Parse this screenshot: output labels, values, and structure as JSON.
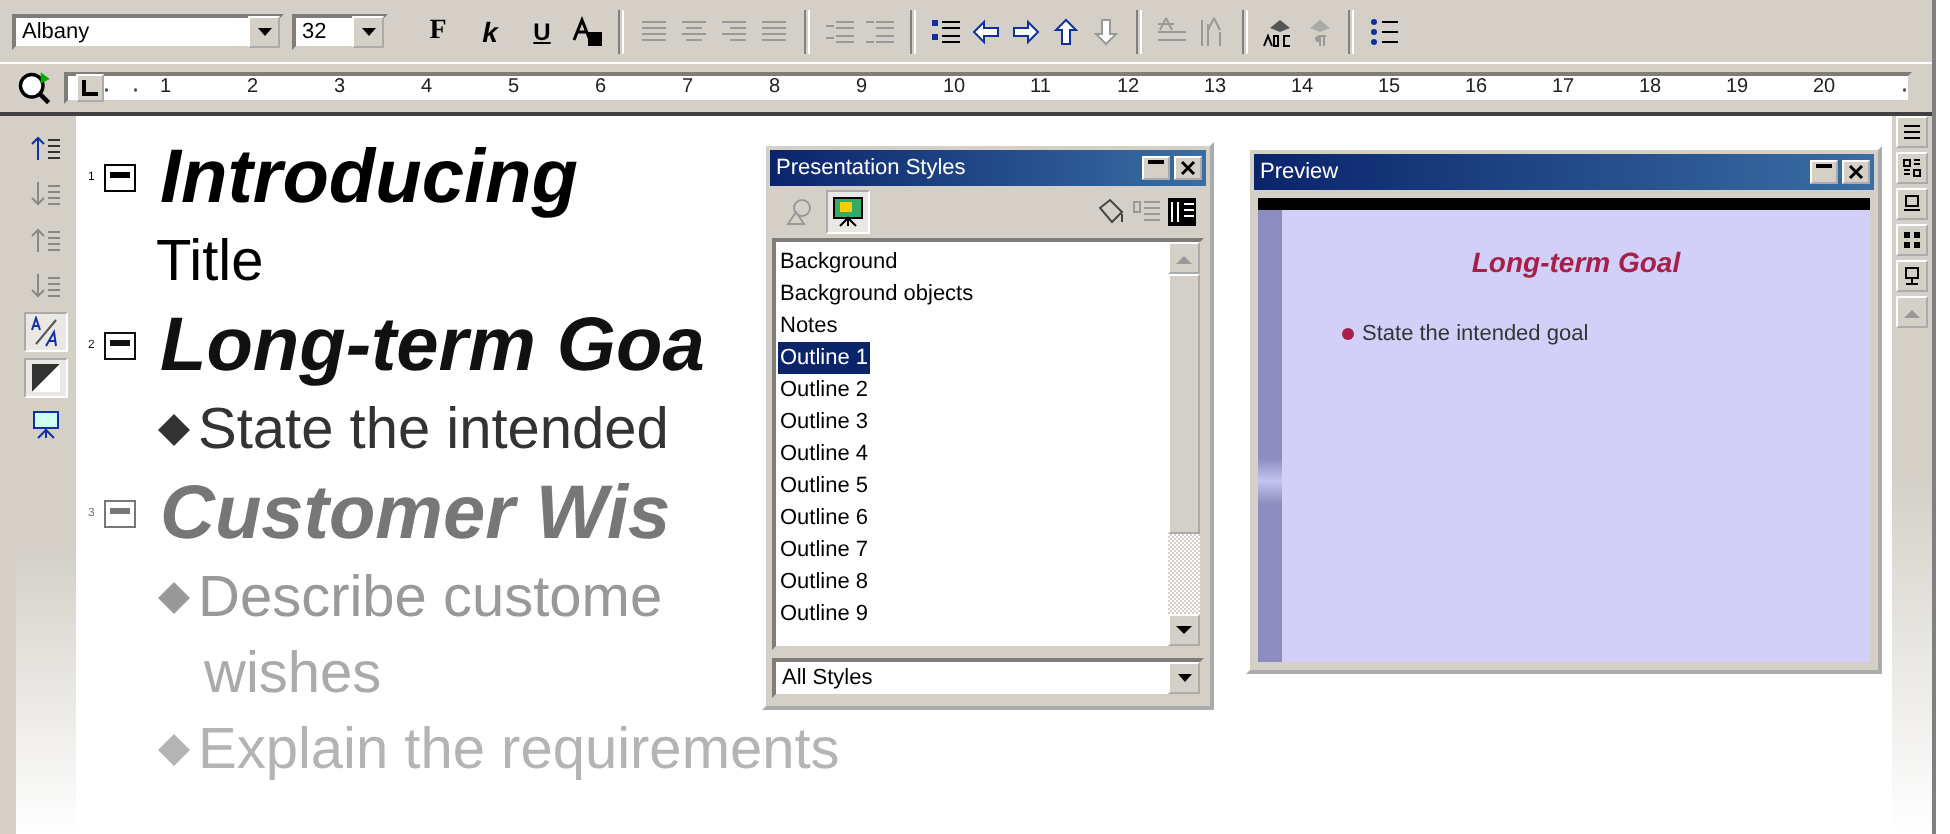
{
  "toolbar": {
    "font": "Albany",
    "size": "32",
    "format_buttons": [
      {
        "kind": "bold",
        "label": "F"
      },
      {
        "kind": "italic",
        "label": "k"
      },
      {
        "kind": "underline",
        "label": "U"
      }
    ]
  },
  "ruler": {
    "marks": [
      "1",
      "2",
      "3",
      "4",
      "5",
      "6",
      "7",
      "8",
      "9",
      "10",
      "11",
      "12",
      "13",
      "14",
      "15",
      "16",
      "17",
      "18",
      "19",
      "20"
    ]
  },
  "left_tools": [
    {
      "kind": "promote",
      "pressed": false
    },
    {
      "kind": "demote",
      "pressed": false
    },
    {
      "kind": "move-up",
      "pressed": false
    },
    {
      "kind": "move-down",
      "pressed": false
    },
    {
      "kind": "format",
      "pressed": true
    },
    {
      "kind": "black-white",
      "pressed": true
    },
    {
      "kind": "slide-show",
      "pressed": false
    }
  ],
  "outline": [
    {
      "kind": "title",
      "number": "1",
      "text": "Introducing"
    },
    {
      "kind": "subtitle",
      "text": "Title"
    },
    {
      "kind": "title",
      "number": "2",
      "text": "Long-term Goa"
    },
    {
      "kind": "bullet",
      "text": "State the intended"
    },
    {
      "kind": "title",
      "number": "3",
      "text": "Customer Wis"
    },
    {
      "kind": "bullet",
      "text": "Describe custome"
    },
    {
      "kind": "continuation",
      "text": "wishes"
    },
    {
      "kind": "bullet",
      "text": "Explain the requirements"
    }
  ],
  "styles_window": {
    "title": "Presentation Styles",
    "modes": [
      {
        "kind": "graphic",
        "selected": false
      },
      {
        "kind": "presentation",
        "selected": true
      }
    ],
    "items": [
      {
        "label": "Background",
        "selected": false
      },
      {
        "label": "Background objects",
        "selected": false
      },
      {
        "label": "Notes",
        "selected": false
      },
      {
        "label": "Outline 1",
        "selected": true
      },
      {
        "label": "Outline 2",
        "selected": false
      },
      {
        "label": "Outline 3",
        "selected": false
      },
      {
        "label": "Outline 4",
        "selected": false
      },
      {
        "label": "Outline 5",
        "selected": false
      },
      {
        "label": "Outline 6",
        "selected": false
      },
      {
        "label": "Outline 7",
        "selected": false
      },
      {
        "label": "Outline 8",
        "selected": false
      },
      {
        "label": "Outline 9",
        "selected": false
      }
    ],
    "filter": "All Styles"
  },
  "preview_window": {
    "title": "Preview",
    "slide_title": "Long-term Goal",
    "bullets": [
      "State the intended goal"
    ]
  }
}
